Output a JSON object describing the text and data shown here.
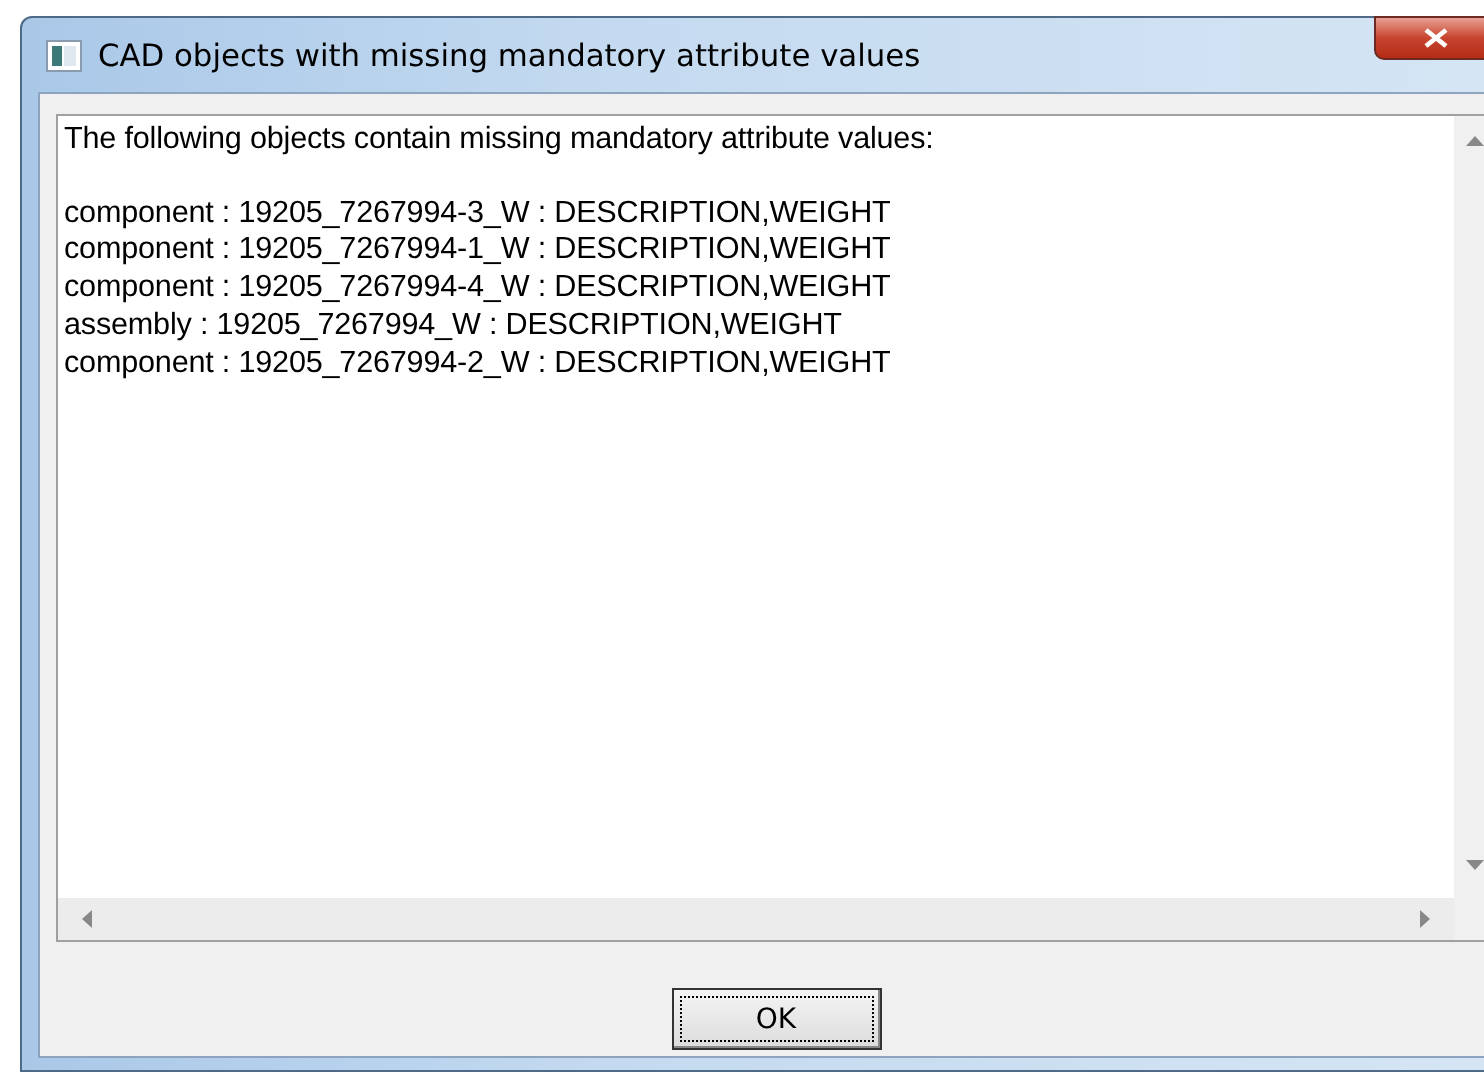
{
  "window": {
    "title": "CAD objects with missing mandatory attribute values"
  },
  "message": {
    "header": "The following objects contain missing mandatory attribute values:",
    "lines": [
      "component : 19205_7267994-3_W : DESCRIPTION,WEIGHT",
      "component : 19205_7267994-1_W : DESCRIPTION,WEIGHT",
      "component : 19205_7267994-4_W : DESCRIPTION,WEIGHT",
      "assembly : 19205_7267994_W : DESCRIPTION,WEIGHT",
      "component : 19205_7267994-2_W : DESCRIPTION,WEIGHT"
    ]
  },
  "buttons": [
    "OK"
  ]
}
